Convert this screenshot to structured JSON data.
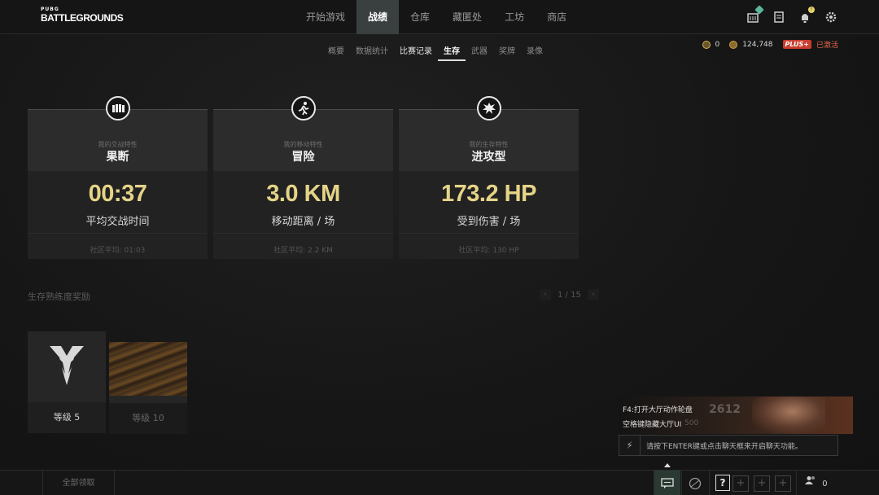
{
  "logo": {
    "small": "PUBG",
    "big": "BATTLEGROUNDS"
  },
  "nav": {
    "items": [
      {
        "label": "开始游戏"
      },
      {
        "label": "战绩"
      },
      {
        "label": "仓库"
      },
      {
        "label": "藏匿处"
      },
      {
        "label": "工坊"
      },
      {
        "label": "商店"
      }
    ],
    "active_index": 1
  },
  "top_icons": {
    "notification_badge": "!"
  },
  "subnav": {
    "items": [
      {
        "label": "概要"
      },
      {
        "label": "数据统计"
      },
      {
        "label": "比赛记录"
      },
      {
        "label": "生存"
      },
      {
        "label": "武器"
      },
      {
        "label": "奖牌"
      },
      {
        "label": "录像"
      }
    ],
    "active_index": 3
  },
  "currency": {
    "bp": "0",
    "gcoin": "124,748",
    "plus_label": "PLUS+",
    "plus_status": "已激活"
  },
  "cards": [
    {
      "icon": "bullets-icon",
      "label": "我的交战特性",
      "trait": "果断",
      "value": "00:37",
      "desc": "平均交战时间",
      "community": "社区平均: 01:03"
    },
    {
      "icon": "runner-icon",
      "label": "我的移动特性",
      "trait": "冒险",
      "value": "3.0 KM",
      "desc": "移动距离 / 场",
      "community": "社区平均: 2.2 KM"
    },
    {
      "icon": "explosion-icon",
      "label": "我的生存特性",
      "trait": "进攻型",
      "value": "173.2 HP",
      "desc": "受到伤害 / 场",
      "community": "社区平均: 130 HP"
    }
  ],
  "rewards_section": {
    "title": "生存熟练度奖励",
    "page": "1 / 15",
    "prev": "‹",
    "next": "›",
    "items": [
      {
        "level": "等级 5"
      },
      {
        "level": "等级 10"
      }
    ]
  },
  "chat": {
    "notice_line1": "F4:打开大厅动作轮盘",
    "notice_line2": "空格键隐藏大厅UI",
    "ghost1": "2612",
    "ghost2": "500",
    "input_hint": "请按下ENTER键或点击聊天框来开启聊天功能。"
  },
  "bottom": {
    "claim_all": "全部领取",
    "help": "?",
    "slot": "+",
    "friends_count": "0"
  },
  "colors": {
    "accent_value": "#e5d487",
    "plus_red": "#c83d2e"
  }
}
